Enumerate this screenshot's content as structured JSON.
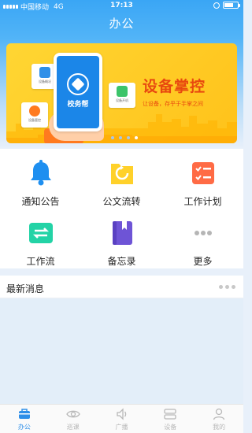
{
  "status_bar": {
    "carrier": "中国移动",
    "network": "4G",
    "time": "17:13"
  },
  "header": {
    "title": "办公"
  },
  "banner": {
    "title": "设备掌控",
    "subtitle": "让设备，存乎于手掌之间",
    "phone_label": "校务帮",
    "tiles": [
      "设备概况",
      "设备开机",
      "设备管控"
    ],
    "slide_count": 4,
    "active_slide": 4
  },
  "menu": {
    "items": [
      {
        "label": "通知公告",
        "icon": "bell-icon"
      },
      {
        "label": "公文流转",
        "icon": "document-refresh-icon"
      },
      {
        "label": "工作计划",
        "icon": "checklist-icon"
      },
      {
        "label": "工作流",
        "icon": "workflow-arrows-icon"
      },
      {
        "label": "备忘录",
        "icon": "memo-book-icon"
      },
      {
        "label": "更多",
        "icon": "more-dots-icon"
      }
    ]
  },
  "news": {
    "title": "最新消息"
  },
  "tabbar": {
    "items": [
      {
        "label": "办公",
        "icon": "briefcase-icon",
        "active": true
      },
      {
        "label": "巡课",
        "icon": "eye-icon",
        "active": false
      },
      {
        "label": "广播",
        "icon": "speaker-icon",
        "active": false
      },
      {
        "label": "设备",
        "icon": "device-icon",
        "active": false
      },
      {
        "label": "我的",
        "icon": "user-icon",
        "active": false
      }
    ]
  },
  "colors": {
    "primary": "#3aa6f5",
    "banner_yellow": "#ffd633",
    "banner_text": "#e8490f",
    "active_tab": "#2f8fe8",
    "inactive_tab": "#b8b8b8"
  }
}
